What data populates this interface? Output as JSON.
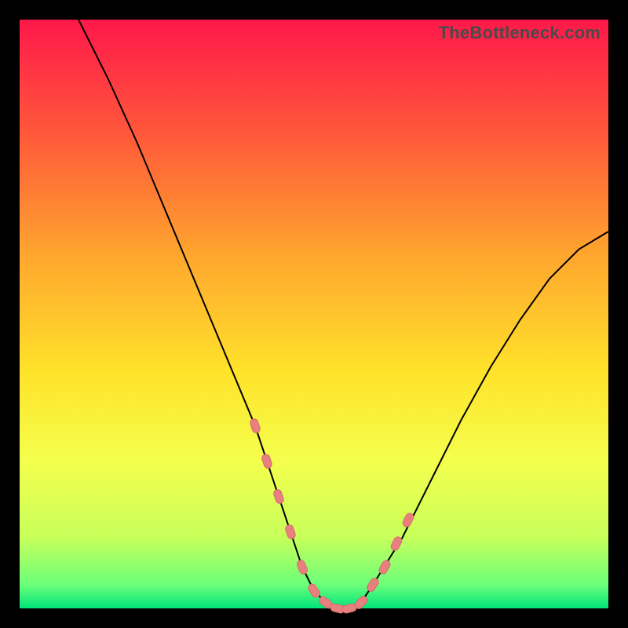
{
  "watermark": "TheBottleneck.com",
  "chart_data": {
    "type": "line",
    "title": "",
    "xlabel": "",
    "ylabel": "",
    "xlim": [
      0,
      100
    ],
    "ylim": [
      0,
      100
    ],
    "grid": false,
    "series": [
      {
        "name": "bottleneck-curve",
        "x": [
          10,
          15,
          20,
          25,
          30,
          35,
          40,
          45,
          48,
          50,
          52,
          54,
          56,
          58,
          60,
          65,
          70,
          75,
          80,
          85,
          90,
          95,
          100
        ],
        "values": [
          100,
          90,
          79,
          67,
          55,
          43,
          31,
          16,
          7,
          3,
          1,
          0,
          0,
          1,
          4,
          12,
          22,
          32,
          41,
          49,
          56,
          61,
          64
        ]
      }
    ],
    "markers": {
      "name": "highlight-points",
      "x": [
        40,
        42,
        44,
        46,
        48,
        50,
        52,
        54,
        56,
        58,
        60,
        62,
        64,
        66
      ],
      "values": [
        31,
        25,
        19,
        13,
        7,
        3,
        1,
        0,
        0,
        1,
        4,
        7,
        11,
        15
      ]
    },
    "background_gradient": {
      "top": "#ff184a",
      "bottom": "#00e47a"
    }
  }
}
